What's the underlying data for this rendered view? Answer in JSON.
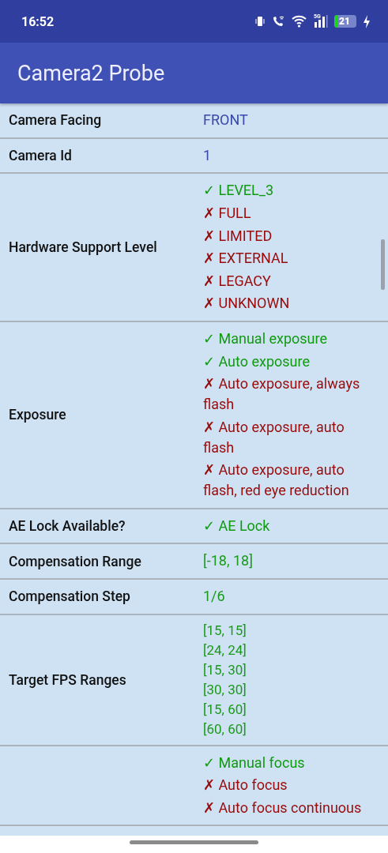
{
  "status_bar": {
    "time": "16:52",
    "network": "5G",
    "battery": "21"
  },
  "app_bar": {
    "title": "Camera2 Probe"
  },
  "rows": [
    {
      "label": "Camera Facing",
      "values": [
        {
          "kind": "info",
          "text": "FRONT"
        }
      ]
    },
    {
      "label": "Camera Id",
      "values": [
        {
          "kind": "info",
          "text": "1"
        }
      ]
    },
    {
      "label": "Hardware Support Level",
      "values": [
        {
          "kind": "yes",
          "mark": "✓",
          "text": "LEVEL_3"
        },
        {
          "kind": "no",
          "mark": "✗",
          "text": "FULL"
        },
        {
          "kind": "no",
          "mark": "✗",
          "text": "LIMITED"
        },
        {
          "kind": "no",
          "mark": "✗",
          "text": "EXTERNAL"
        },
        {
          "kind": "no",
          "mark": "✗",
          "text": "LEGACY"
        },
        {
          "kind": "no",
          "mark": "✗",
          "text": "UNKNOWN"
        }
      ]
    },
    {
      "label": "Exposure",
      "values": [
        {
          "kind": "yes",
          "mark": "✓",
          "text": "Manual exposure"
        },
        {
          "kind": "yes",
          "mark": "✓",
          "text": "Auto exposure"
        },
        {
          "kind": "no",
          "mark": "✗",
          "text": "Auto exposure, always flash"
        },
        {
          "kind": "no",
          "mark": "✗",
          "text": "Auto exposure, auto flash"
        },
        {
          "kind": "no",
          "mark": "✗",
          "text": "Auto exposure, auto flash, red eye reduction"
        }
      ]
    },
    {
      "label": "AE Lock Available?",
      "values": [
        {
          "kind": "yes",
          "mark": "✓",
          "text": "AE Lock"
        }
      ]
    },
    {
      "label": "Compensation Range",
      "values": [
        {
          "kind": "value",
          "text": "[-18, 18]"
        }
      ]
    },
    {
      "label": "Compensation Step",
      "values": [
        {
          "kind": "value",
          "text": "1/6"
        }
      ]
    },
    {
      "label": "Target FPS Ranges",
      "values": [
        {
          "kind": "range",
          "text": "[15, 15]"
        },
        {
          "kind": "range",
          "text": "[24, 24]"
        },
        {
          "kind": "range",
          "text": "[15, 30]"
        },
        {
          "kind": "range",
          "text": "[30, 30]"
        },
        {
          "kind": "range",
          "text": "[15, 60]"
        },
        {
          "kind": "range",
          "text": "[60, 60]"
        }
      ]
    },
    {
      "values": [
        {
          "kind": "yes",
          "mark": "✓",
          "text": "Manual focus"
        },
        {
          "kind": "no",
          "mark": "✗",
          "text": "Auto focus"
        },
        {
          "kind": "no",
          "mark": "✗",
          "text": "Auto focus continuous"
        }
      ]
    }
  ]
}
